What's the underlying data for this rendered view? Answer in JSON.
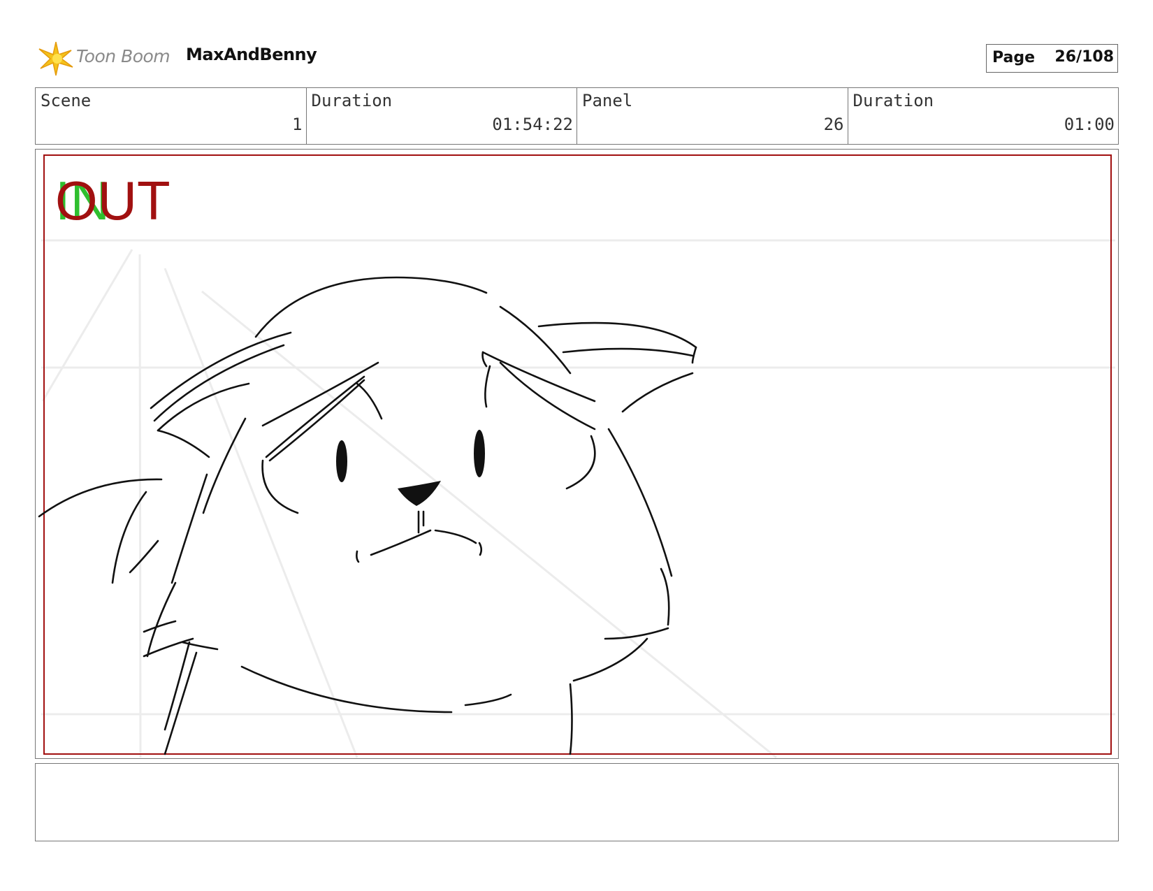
{
  "header": {
    "logo_text": "Toon Boom",
    "project_title": "MaxAndBenny",
    "page_label": "Page",
    "page_value": "26/108"
  },
  "info": {
    "scene_label": "Scene",
    "scene_value": "1",
    "scene_duration_label": "Duration",
    "scene_duration_value": "01:54:22",
    "panel_label": "Panel",
    "panel_value": "26",
    "panel_duration_label": "Duration",
    "panel_duration_value": "01:00"
  },
  "panel": {
    "in_marker": "IN",
    "out_marker": "OUT",
    "frame_color": "#a11010",
    "in_color": "#2fbf2f",
    "out_color": "#a11010"
  },
  "notes": {
    "text": ""
  }
}
